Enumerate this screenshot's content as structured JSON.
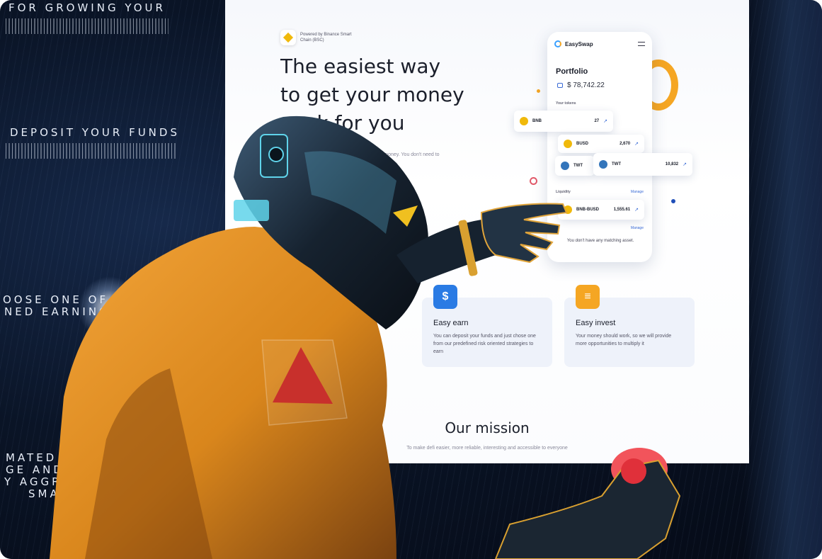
{
  "background_text": {
    "line1": "FOR GROWING YOUR",
    "line2": "DEPOSIT YOUR FUNDS",
    "line3a": "OOSE ONE OF THE",
    "line3b": "NED EARNING STRATEGIES",
    "line4a": "MATED DECENTRALIZED",
    "line4b": "GE AND AUTOMATED",
    "line4c": "Y AGGREGATOR ON THE",
    "line4d": "SMART CHAIN."
  },
  "site": {
    "powered_by": "Powered by Binance Smart Chain (BSC)",
    "hero_title_lines": [
      "The easiest way",
      "to get your money",
      "work for you"
    ],
    "hero_subtitle": "r money. You don't need to"
  },
  "phone": {
    "app_name": "EasySwap",
    "portfolio_title": "Portfolio",
    "balance": "$ 78,742.22",
    "tokens_label": "Your tokens",
    "liquidity_label": "Liquidity",
    "manage_label": "Manage",
    "manage_label_2": "Manage",
    "empty_note": "You don't have any matching asset."
  },
  "assets": [
    {
      "name": "BNB",
      "value": "27",
      "color": "#f0b90b"
    },
    {
      "name": "BUSD",
      "value": "2,670",
      "color": "#f0b90b"
    },
    {
      "name": "TWT",
      "value": "",
      "color": "#3375bb"
    },
    {
      "name": "TWT",
      "value": "10,832",
      "color": "#3375bb"
    },
    {
      "name": "BNB-BUSD",
      "value": "1,555.61",
      "color": "#f0b90b"
    }
  ],
  "features": [
    {
      "title": "Easy earn",
      "desc": "You can deposit your funds and just chose one from our predefined risk oriented strategies to earn",
      "icon": "money-bag-icon",
      "color": "#2a7be4"
    },
    {
      "title": "Easy invest",
      "desc": "Your money should work, so we will provide more opportunities to multiply it",
      "icon": "stack-icon",
      "color": "#f5a623"
    }
  ],
  "mission": {
    "title": "Our mission",
    "subtitle": "To make defi easier, more reliable, interesting and accessible to everyone"
  },
  "colors": {
    "accent_orange": "#f5a623",
    "accent_blue": "#2a7be4",
    "suit": "#e8951e",
    "background_dark": "#0a1426"
  }
}
